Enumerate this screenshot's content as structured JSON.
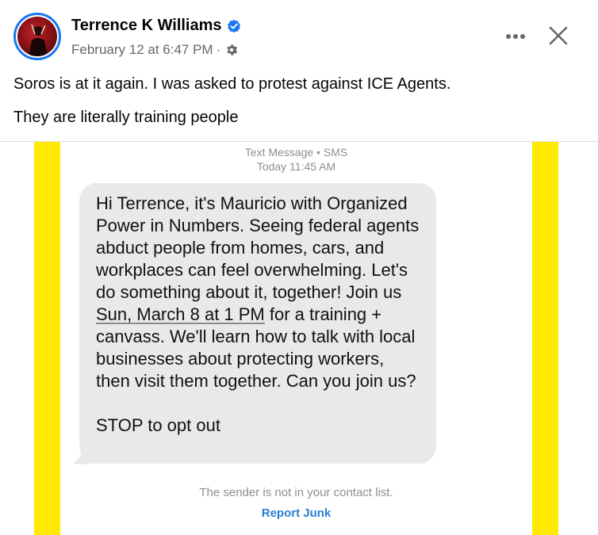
{
  "post": {
    "author_name": "Terrence K Williams",
    "timestamp": "February 12 at 6:47 PM",
    "separator": "·",
    "icons": {
      "verified": "verified-badge-icon",
      "audience": "gear-icon",
      "more": "more-horizontal-icon",
      "close": "close-icon"
    },
    "text_lines": [
      "Soros is at it again. I was asked to protest against ICE Agents.",
      "They are literally training people"
    ]
  },
  "attached_image": {
    "sms_header_line1": "Text Message • SMS",
    "sms_header_line2": "Today 11:45 AM",
    "message_part1": "Hi Terrence, it's Mauricio with Organized Power in Numbers. Seeing federal agents abduct people from homes, cars, and workplaces can feel overwhelming. Let's do something about it, together! Join us ",
    "message_date": "Sun, March 8 at 1 PM",
    "message_part2": " for a training + canvass. We'll learn how to talk with local businesses about protecting workers, then visit them together. Can you join us?",
    "message_stop": "STOP to opt out",
    "sender_note": "The sender is not in your contact list.",
    "report_junk": "Report Junk"
  },
  "colors": {
    "verified_blue": "#1877f2",
    "accent_yellow": "#ffea00",
    "link_blue": "#2a7fd4",
    "bubble_gray": "#e9e9eb"
  }
}
